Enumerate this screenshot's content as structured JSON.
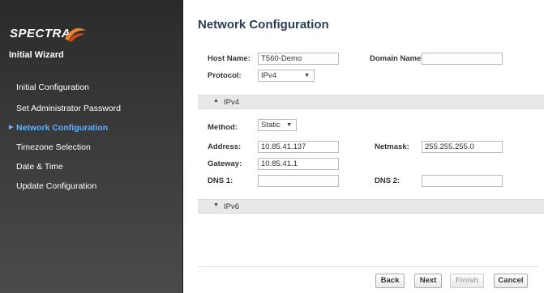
{
  "sidebar": {
    "logo_text": "SPECTRA",
    "wizard_title": "Initial Wizard",
    "items": [
      {
        "label": "Initial Configuration"
      },
      {
        "label": "Set Administrator Password"
      },
      {
        "label": "Network Configuration"
      },
      {
        "label": "Timezone Selection"
      },
      {
        "label": "Date & Time"
      },
      {
        "label": "Update Configuration"
      }
    ]
  },
  "main": {
    "title": "Network Configuration",
    "host_name_label": "Host Name:",
    "host_name_value": "T560-Demo",
    "domain_name_label": "Domain Name:",
    "domain_name_value": "",
    "protocol_label": "Protocol:",
    "protocol_value": "IPv4",
    "ipv4_section": "IPv4",
    "method_label": "Method:",
    "method_value": "Static",
    "address_label": "Address:",
    "address_value": "10.85.41.137",
    "netmask_label": "Netmask:",
    "netmask_value": "255.255.255.0",
    "gateway_label": "Gateway:",
    "gateway_value": "10.85.41.1",
    "dns1_label": "DNS 1:",
    "dns1_value": "",
    "dns2_label": "DNS 2:",
    "dns2_value": "",
    "ipv6_section": "IPv6"
  },
  "footer": {
    "back": "Back",
    "next": "Next",
    "finish": "Finish",
    "cancel": "Cancel"
  },
  "icons": {
    "active_marker": "play-icon",
    "section_expanded": "chevron-up-icon",
    "section_collapsed": "chevron-down-icon",
    "dropdown": "caret-down-icon"
  },
  "colors": {
    "sidebar_bg": "#2a2a2a",
    "active_nav": "#5eb3ff",
    "title": "#2c3e50",
    "logo_swoosh": "#e8892b"
  }
}
